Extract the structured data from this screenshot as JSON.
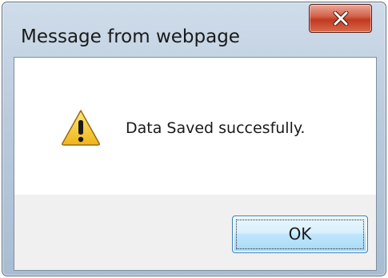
{
  "window": {
    "title": "Message from webpage",
    "close_icon": "close-x-icon"
  },
  "dialog": {
    "icon": "warning-icon",
    "message": "Data Saved succesfully.",
    "ok_label": "OK"
  },
  "colors": {
    "frame": "#b9cadc",
    "close_button": "#c13a21",
    "content_background": "#ffffff",
    "button_bar": "#f0f0f0",
    "ok_button_border": "#3c7fb1",
    "warning_fill": "#f3c21b"
  }
}
